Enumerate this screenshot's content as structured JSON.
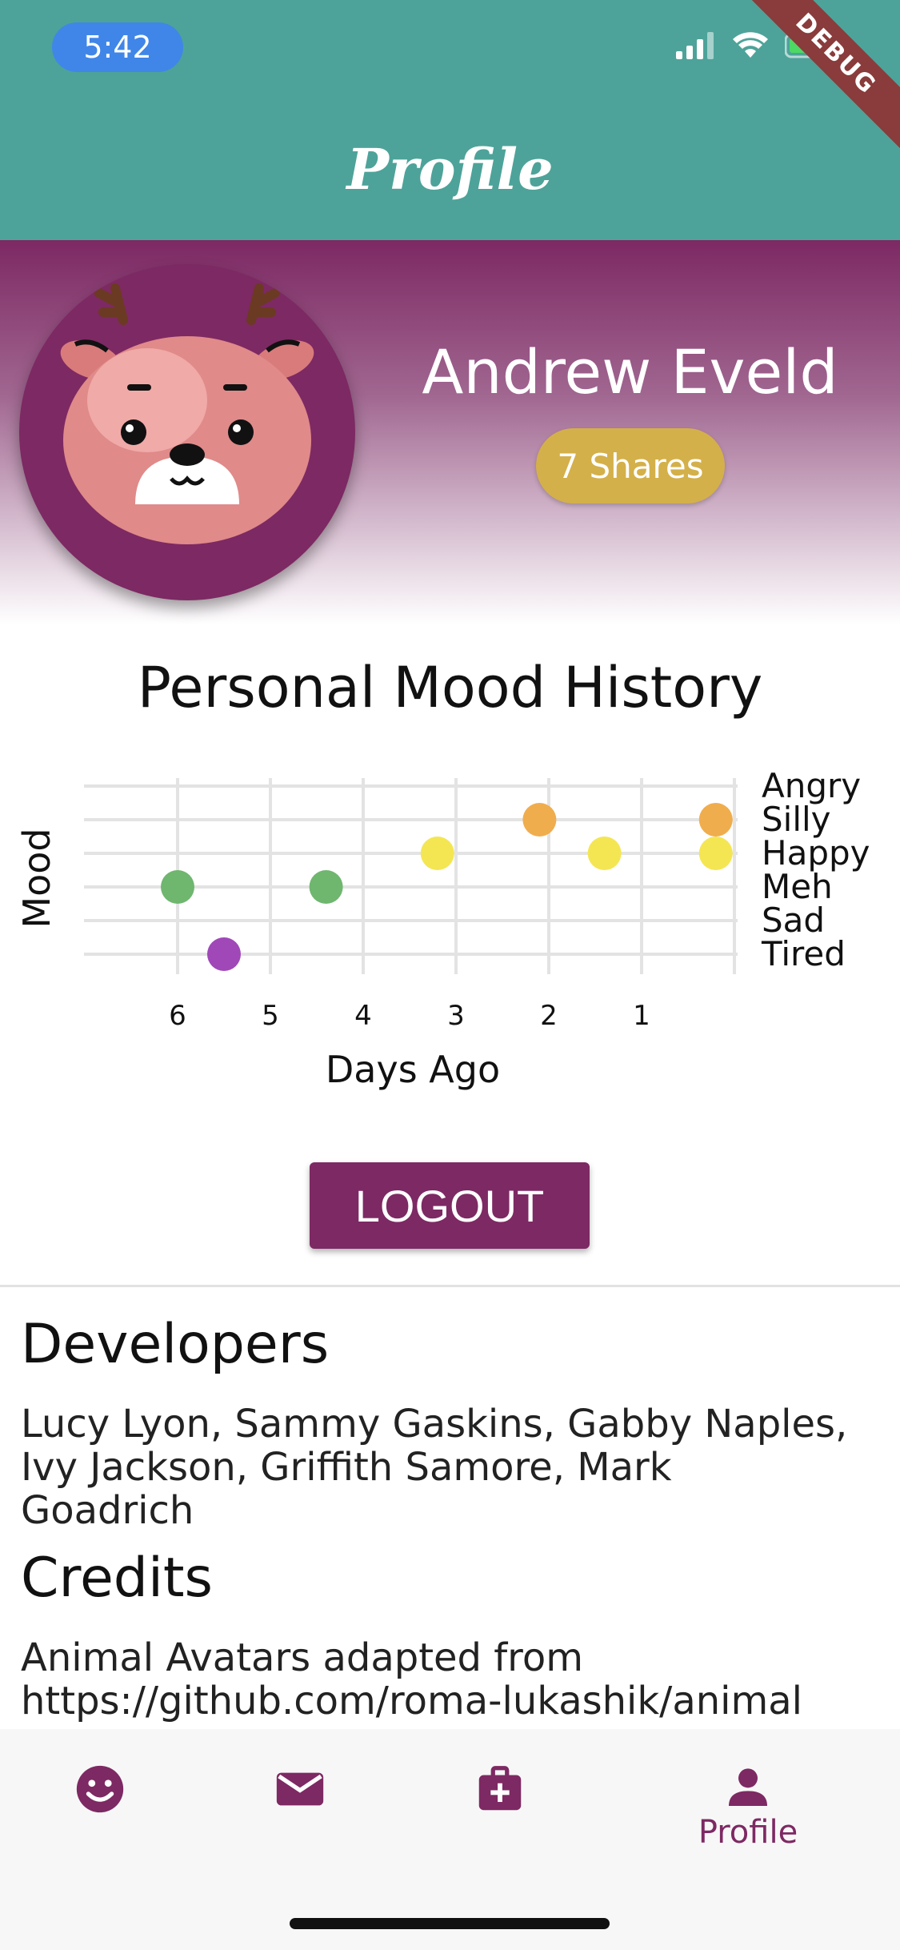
{
  "status_bar": {
    "time": "5:42",
    "debug_label": "DEBUG"
  },
  "app_bar": {
    "title": "Profile"
  },
  "profile": {
    "name": "Andrew Eveld",
    "shares": "7 Shares",
    "avatar_icon": "deer-avatar-icon"
  },
  "chart_title": "Personal Mood History",
  "chart_data": {
    "type": "scatter",
    "title": "Personal Mood History",
    "xlabel": "Days Ago",
    "ylabel": "Mood",
    "x_ticks": [
      "6",
      "5",
      "4",
      "3",
      "2",
      "1"
    ],
    "y_categories": [
      "Tired",
      "Sad",
      "Meh",
      "Happy",
      "Silly",
      "Angry"
    ],
    "xlim": [
      7,
      0
    ],
    "grid": true,
    "points": [
      {
        "x": 6.0,
        "y": "Meh",
        "color": "#6fb66f"
      },
      {
        "x": 5.5,
        "y": "Tired",
        "color": "#a048b8"
      },
      {
        "x": 4.4,
        "y": "Meh",
        "color": "#6fb66f"
      },
      {
        "x": 3.2,
        "y": "Happy",
        "color": "#f4e653"
      },
      {
        "x": 2.1,
        "y": "Silly",
        "color": "#f0ad4e"
      },
      {
        "x": 1.4,
        "y": "Happy",
        "color": "#f4e653"
      },
      {
        "x": 0.2,
        "y": "Silly",
        "color": "#f0ad4e"
      },
      {
        "x": 0.2,
        "y": "Happy",
        "color": "#f4e653"
      }
    ]
  },
  "logout_label": "LOGOUT",
  "developers": {
    "heading": "Developers",
    "lines": [
      "Lucy Lyon, Sammy Gaskins, Gabby Naples,",
      "Ivy Jackson, Griffith Samore, Mark",
      "Goadrich"
    ]
  },
  "credits": {
    "heading": "Credits",
    "lines": [
      "Animal Avatars adapted from",
      "https://github.com/roma-lukashik/animal"
    ]
  },
  "bottom_nav": {
    "items": [
      {
        "icon": "smiley-icon",
        "label": ""
      },
      {
        "icon": "mail-icon",
        "label": ""
      },
      {
        "icon": "first-aid-kit-icon",
        "label": ""
      },
      {
        "icon": "person-icon",
        "label": "Profile"
      }
    ]
  },
  "colors": {
    "app_bar": "#4da399",
    "accent": "#7d2963",
    "shares_pill": "#d4b04a"
  }
}
